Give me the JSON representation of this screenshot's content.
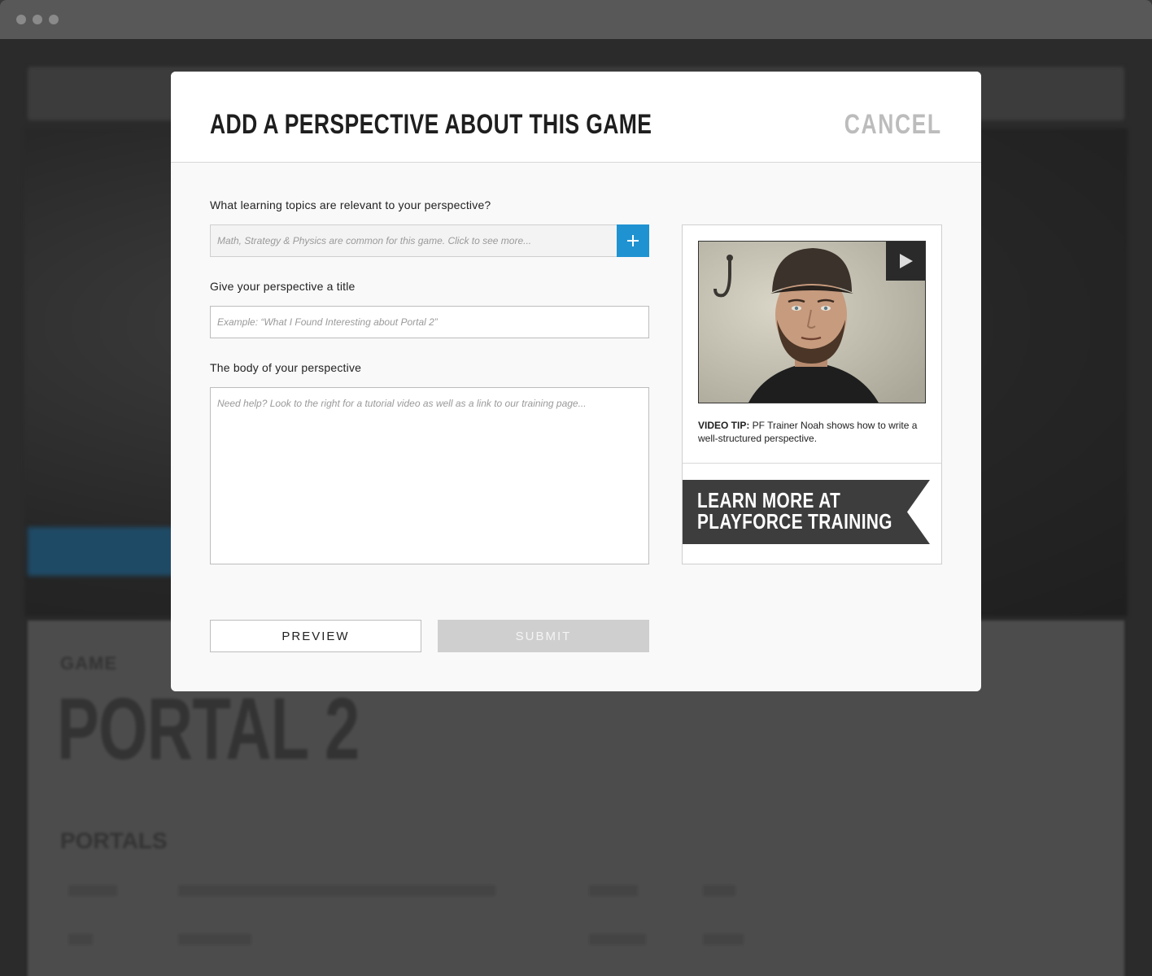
{
  "window": {
    "controls": [
      "close-dot",
      "minimize-dot",
      "zoom-dot"
    ]
  },
  "background_page": {
    "game_label": "GAME",
    "game_title": "PORTAL 2",
    "section_label": "PORTALS"
  },
  "modal": {
    "title": "ADD A PERSPECTIVE ABOUT THIS GAME",
    "cancel_label": "CANCEL",
    "topics": {
      "label": "What learning topics are relevant to your perspective?",
      "placeholder": "Math, Strategy & Physics are common for this game. Click to see more...",
      "add_icon": "plus-icon"
    },
    "title_field": {
      "label": "Give your perspective a title",
      "placeholder": "Example: “What I Found Interesting about Portal 2”"
    },
    "body_field": {
      "label": "The body of your perspective",
      "placeholder": "Need help? Look to the right for a tutorial video as well as a link to our training page..."
    },
    "preview_label": "PREVIEW",
    "submit_label": "SUBMIT"
  },
  "help": {
    "video_tip_bold": "VIDEO TIP:",
    "video_tip_text": " PF Trainer Noah shows how to write a well-structured perspective.",
    "play_icon": "play-icon",
    "ribbon_line1": "LEARN MORE AT",
    "ribbon_line2": "PLAYFORCE TRAINING"
  },
  "colors": {
    "accent_blue": "#1f93d1",
    "ribbon_dark": "#3d3d3d",
    "cancel_gray": "#bcbcbc",
    "submit_disabled": "#cfcfcf"
  }
}
